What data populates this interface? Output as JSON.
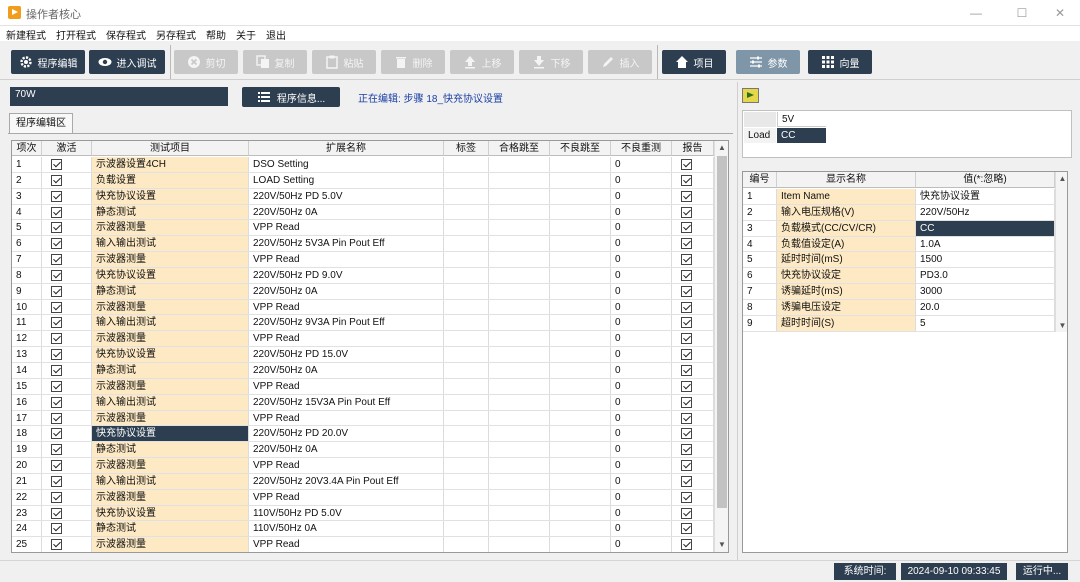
{
  "window": {
    "title": "操作者核心"
  },
  "menu": [
    "新建程式",
    "打开程式",
    "保存程式",
    "另存程式",
    "帮助",
    "关于",
    "退出"
  ],
  "toolbar": {
    "program_edit": "程序编辑",
    "enter_debug": "进入调试",
    "cut": "剪切",
    "copy": "复制",
    "paste": "粘贴",
    "delete": "删除",
    "move_up": "上移",
    "move_down": "下移",
    "insert": "插入",
    "project": "项目",
    "params": "参数",
    "vector": "向量"
  },
  "program": {
    "name": "70W",
    "info_button": "程序信息...",
    "editing_status": "正在编辑: 步骤 18_快充协议设置"
  },
  "tab": "程序编辑区",
  "main_grid": {
    "columns": [
      "项次",
      "激活",
      "测试项目",
      "扩展名称",
      "标签",
      "合格跳至",
      "不良跳至",
      "不良重测",
      "报告"
    ],
    "rows": [
      {
        "no": "1",
        "item": "示波器设置4CH",
        "ext": "DSO Setting",
        "retest": "0"
      },
      {
        "no": "2",
        "item": "负载设置",
        "ext": "LOAD Setting",
        "retest": "0"
      },
      {
        "no": "3",
        "item": "快充协议设置",
        "ext": "220V/50Hz PD 5.0V",
        "retest": "0"
      },
      {
        "no": "4",
        "item": "静态测试",
        "ext": "220V/50Hz 0A",
        "retest": "0"
      },
      {
        "no": "5",
        "item": "示波器测量",
        "ext": "VPP Read",
        "retest": "0"
      },
      {
        "no": "6",
        "item": "输入输出测试",
        "ext": "220V/50Hz 5V3A Pin Pout Eff",
        "retest": "0"
      },
      {
        "no": "7",
        "item": "示波器测量",
        "ext": "VPP Read",
        "retest": "0"
      },
      {
        "no": "8",
        "item": "快充协议设置",
        "ext": "220V/50Hz PD 9.0V",
        "retest": "0"
      },
      {
        "no": "9",
        "item": "静态测试",
        "ext": "220V/50Hz 0A",
        "retest": "0"
      },
      {
        "no": "10",
        "item": "示波器测量",
        "ext": "VPP Read",
        "retest": "0"
      },
      {
        "no": "11",
        "item": "输入输出测试",
        "ext": "220V/50Hz 9V3A Pin Pout Eff",
        "retest": "0"
      },
      {
        "no": "12",
        "item": "示波器测量",
        "ext": "VPP Read",
        "retest": "0"
      },
      {
        "no": "13",
        "item": "快充协议设置",
        "ext": "220V/50Hz PD 15.0V",
        "retest": "0"
      },
      {
        "no": "14",
        "item": "静态测试",
        "ext": "220V/50Hz 0A",
        "retest": "0"
      },
      {
        "no": "15",
        "item": "示波器测量",
        "ext": "VPP Read",
        "retest": "0"
      },
      {
        "no": "16",
        "item": "输入输出测试",
        "ext": "220V/50Hz 15V3A Pin Pout Eff",
        "retest": "0"
      },
      {
        "no": "17",
        "item": "示波器测量",
        "ext": "VPP Read",
        "retest": "0"
      },
      {
        "no": "18",
        "item": "快充协议设置",
        "ext": "220V/50Hz PD 20.0V",
        "retest": "0"
      },
      {
        "no": "19",
        "item": "静态测试",
        "ext": "220V/50Hz 0A",
        "retest": "0"
      },
      {
        "no": "20",
        "item": "示波器测量",
        "ext": "VPP Read",
        "retest": "0"
      },
      {
        "no": "21",
        "item": "输入输出测试",
        "ext": "220V/50Hz 20V3.4A Pin Pout Eff",
        "retest": "0"
      },
      {
        "no": "22",
        "item": "示波器测量",
        "ext": "VPP Read",
        "retest": "0"
      },
      {
        "no": "23",
        "item": "快充协议设置",
        "ext": "110V/50Hz PD 5.0V",
        "retest": "0"
      },
      {
        "no": "24",
        "item": "静态测试",
        "ext": "110V/50Hz 0A",
        "retest": "0"
      },
      {
        "no": "25",
        "item": "示波器测量",
        "ext": "VPP Read",
        "retest": "0"
      }
    ],
    "selected_no": "18"
  },
  "load_box": {
    "header": "5V",
    "row_label": "Load",
    "value": "CC"
  },
  "param_grid": {
    "columns": [
      "编号",
      "显示名称",
      "值(*:忽略)"
    ],
    "rows": [
      {
        "no": "1",
        "name": "Item Name",
        "value": "快充协议设置"
      },
      {
        "no": "2",
        "name": "输入电压规格(V)",
        "value": "220V/50Hz"
      },
      {
        "no": "3",
        "name": "负载模式(CC/CV/CR)",
        "value": "CC"
      },
      {
        "no": "4",
        "name": "负载值设定(A)",
        "value": "1.0A"
      },
      {
        "no": "5",
        "name": "延时时间(mS)",
        "value": "1500"
      },
      {
        "no": "6",
        "name": "快充协议设定",
        "value": "PD3.0"
      },
      {
        "no": "7",
        "name": "诱骗延时(mS)",
        "value": "3000"
      },
      {
        "no": "8",
        "name": "诱骗电压设定",
        "value": "20.0"
      },
      {
        "no": "9",
        "name": "超时时间(S)",
        "value": "5"
      }
    ],
    "selected_no": "3"
  },
  "status": {
    "time_label": "系统时间:",
    "time_value": "2024-09-10 09:33:45",
    "running": "运行中..."
  },
  "colors": {
    "accent_dark": "#2d3e50",
    "highlight": "#fde9c4",
    "link": "#1b3fa5"
  }
}
